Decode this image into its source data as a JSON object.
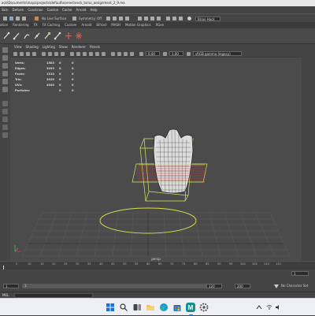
{
  "window": {
    "title": "ack\\Documents\\maya\\projects\\default\\scenes\\neck_torso_assignment_2_9.ma"
  },
  "menubar": {
    "items": [
      "Skin",
      "Deform",
      "Constrain",
      "Control",
      "Cache",
      "Arnold",
      "Help"
    ]
  },
  "statusline": {
    "no_live_surface": "No Live Surface",
    "symmetry": "Symmetry: Off",
    "user": "Brian Hack"
  },
  "shelf": {
    "tabs": [
      "ation",
      "Rendering",
      "FX",
      "FX Caching",
      "Custom",
      "Arnold",
      "Bifrost",
      "MASH",
      "Motion Graphics",
      "XGen"
    ]
  },
  "viewport": {
    "panel_menu": [
      "View",
      "Shading",
      "Lighting",
      "Show",
      "Renderer",
      "Panels"
    ],
    "exposure": "0.00",
    "gamma": "1.00",
    "color_space": "sRGB gamma (legacy)",
    "camera": "persp",
    "hud": [
      {
        "label": "Verts:",
        "v1": "1583",
        "v2": "0",
        "v3": "0"
      },
      {
        "label": "Edges:",
        "v1": "3093",
        "v2": "0",
        "v3": "0"
      },
      {
        "label": "Faces:",
        "v1": "1510",
        "v2": "0",
        "v3": "0"
      },
      {
        "label": "Tris:",
        "v1": "3020",
        "v2": "0",
        "v3": "0"
      },
      {
        "label": "UVs:",
        "v1": "4040",
        "v2": "0",
        "v3": "0"
      },
      {
        "label": "Particles:",
        "v1": "",
        "v2": "0",
        "v3": "0"
      }
    ]
  },
  "timeline": {
    "ticks": [
      "5",
      "10",
      "15",
      "20",
      "25",
      "30",
      "35",
      "40",
      "45",
      "50",
      "55",
      "60",
      "65",
      "70",
      "75",
      "80",
      "85",
      "90",
      "95",
      "100",
      "105",
      "110",
      "115"
    ],
    "current_frame": "1",
    "start": "1",
    "inner_start": "1",
    "inner_end": "120",
    "end": "120",
    "max_end": "200",
    "character_set": "No Character Set"
  },
  "command_line": {
    "language": "MEL"
  },
  "taskbar": {
    "apps": [
      "start",
      "search",
      "task-view",
      "file-explorer",
      "edge",
      "store",
      "maya",
      "settings"
    ],
    "time": "",
    "date": ""
  }
}
